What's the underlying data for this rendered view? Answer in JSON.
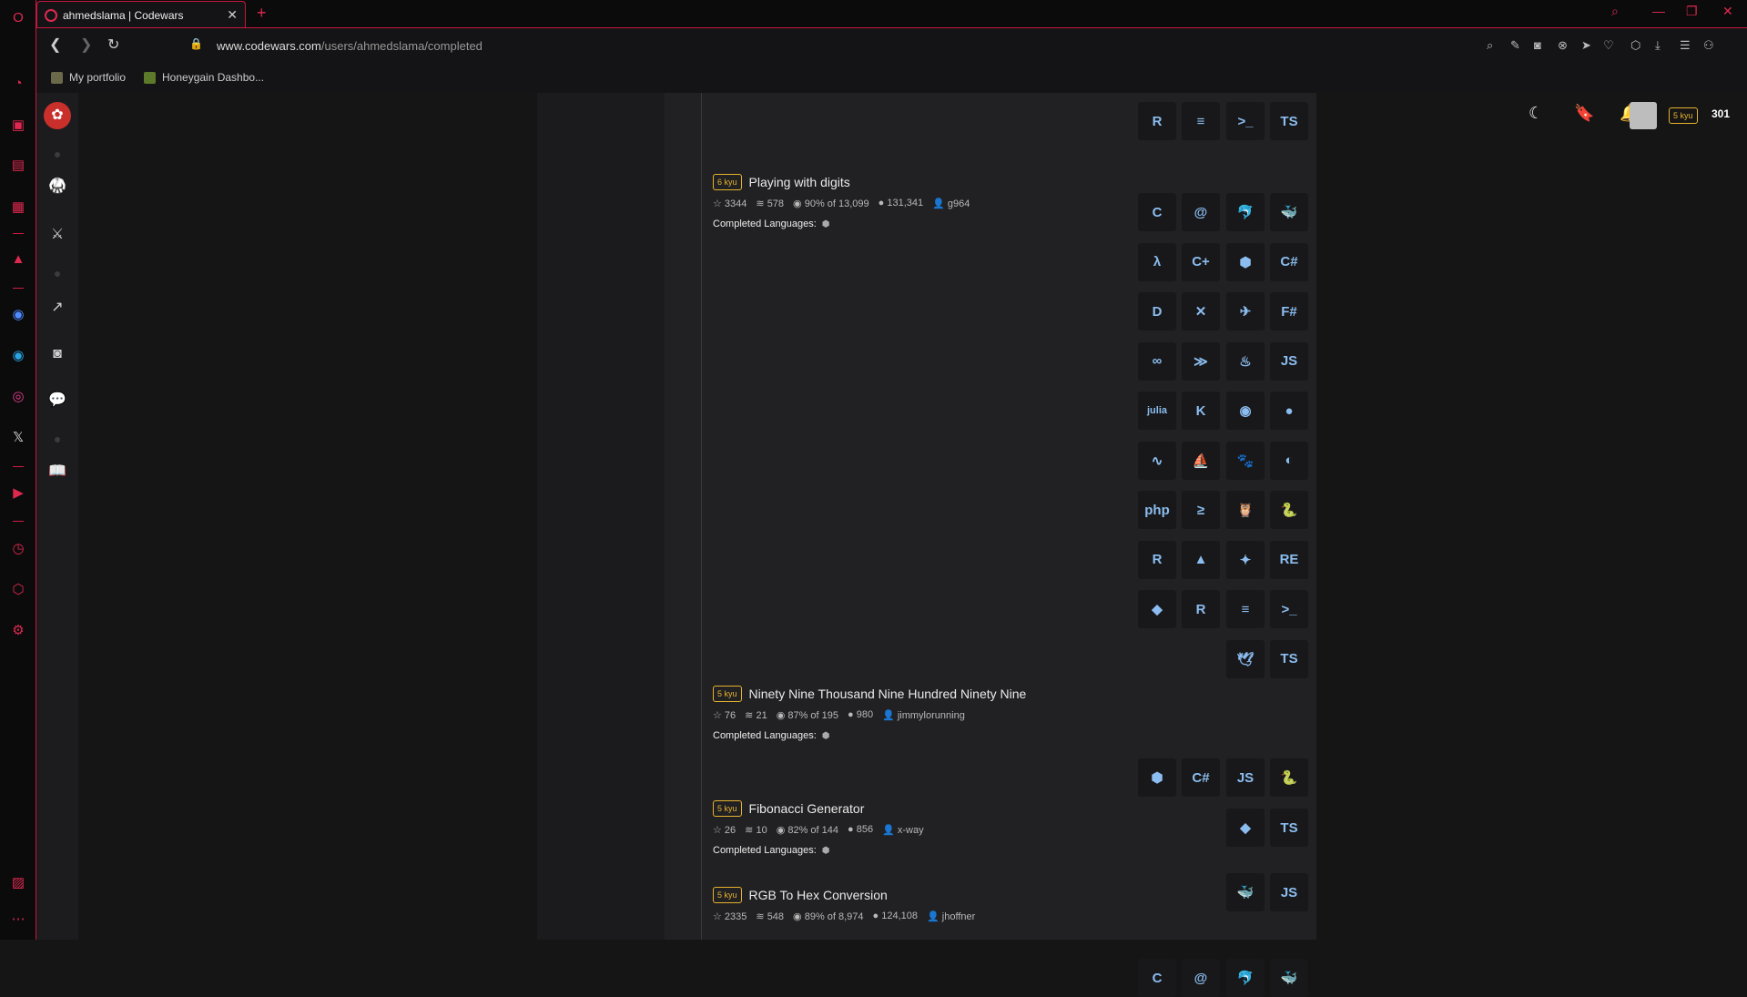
{
  "browser": {
    "tab_title": "ahmedslama | Codewars",
    "url_domain": "www.codewars.com",
    "url_path": "/users/ahmedslama/completed",
    "bookmarks": [
      "My portfolio",
      "Honeygain Dashbo..."
    ]
  },
  "header": {
    "rank": "5 kyu",
    "honor": "301"
  },
  "katas": [
    {
      "rank": "6 kyu",
      "name": "Playing with digits",
      "stars": "3344",
      "collections": "578",
      "satisfaction": "90% of 13,099",
      "completions": "131,341",
      "author": "g964",
      "completed_label": "Completed Languages:"
    },
    {
      "rank": "5 kyu",
      "name": "Ninety Nine Thousand Nine Hundred Ninety Nine",
      "stars": "76",
      "collections": "21",
      "satisfaction": "87% of 195",
      "completions": "980",
      "author": "jimmylorunning",
      "completed_label": "Completed Languages:"
    },
    {
      "rank": "5 kyu",
      "name": "Fibonacci Generator",
      "stars": "26",
      "collections": "10",
      "satisfaction": "82% of 144",
      "completions": "856",
      "author": "x-way",
      "completed_label": "Completed Languages:"
    },
    {
      "rank": "5 kyu",
      "name": "RGB To Hex Conversion",
      "stars": "2335",
      "collections": "548",
      "satisfaction": "89% of 8,974",
      "completions": "124,108",
      "author": "jhoffner",
      "completed_label": "Completed Languages:"
    }
  ],
  "tiles": {
    "top": [
      "R",
      "≡",
      ">_",
      "TS"
    ],
    "k1": [
      "C",
      "@",
      "🐬",
      "🐳",
      "λ",
      "C+",
      "⬢",
      "C#",
      "D",
      "✕",
      "✈",
      "F#",
      "∞",
      "≫",
      "♨",
      "JS",
      "julia",
      "K",
      "◉",
      "●",
      "∿",
      "⛵",
      "🐾",
      "◐",
      "php",
      "≥",
      "🦉",
      "🐍",
      "R",
      "▲",
      "✦",
      "RE",
      "◆",
      "R",
      "≡",
      ">_",
      "🕊",
      "TS"
    ],
    "k2": [
      "⬢",
      "C#",
      "JS",
      "🐍",
      "◆",
      "TS"
    ],
    "k3": [
      "🐳",
      "JS"
    ],
    "k4": [
      "C",
      "@",
      "🐬",
      "🐳"
    ]
  },
  "colors": {
    "accent": "#e0284f",
    "rank_badge": "#e6b22e",
    "lang_icon": "#8bbdf0"
  }
}
